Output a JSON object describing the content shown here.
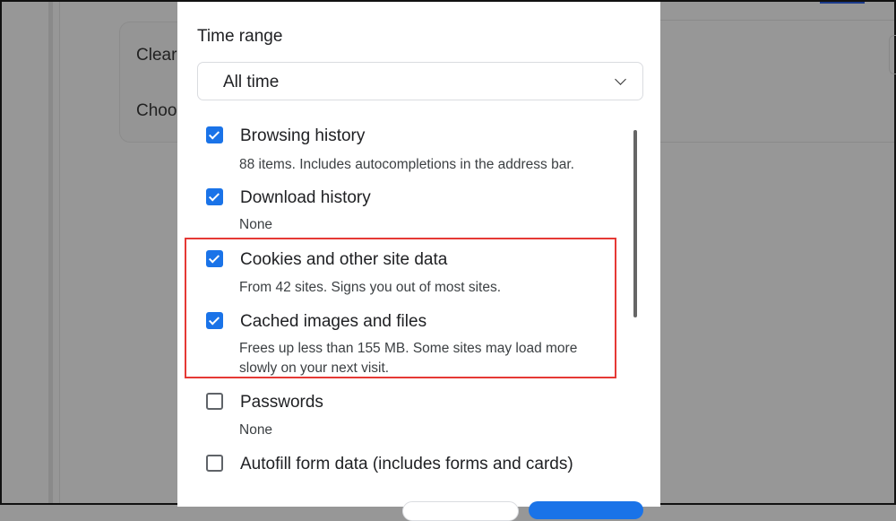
{
  "background": {
    "card_line1": "Clear",
    "card_line2": "Choo"
  },
  "dialog": {
    "time_range_label": "Time range",
    "time_range_value": "All time",
    "items": [
      {
        "title": "Browsing history",
        "desc": "88 items. Includes autocompletions in the address bar.",
        "checked": true
      },
      {
        "title": "Download history",
        "desc": "None",
        "checked": true
      },
      {
        "title": "Cookies and other site data",
        "desc": "From 42 sites. Signs you out of most sites.",
        "checked": true
      },
      {
        "title": "Cached images and files",
        "desc": "Frees up less than 155 MB. Some sites may load more",
        "desc2": "slowly on your next visit.",
        "checked": true
      },
      {
        "title": "Passwords",
        "desc": "None",
        "checked": false
      },
      {
        "title": "Autofill form data (includes forms and cards)",
        "checked": false
      }
    ]
  },
  "colors": {
    "accent": "#1a73e8",
    "highlight": "#e53935"
  }
}
